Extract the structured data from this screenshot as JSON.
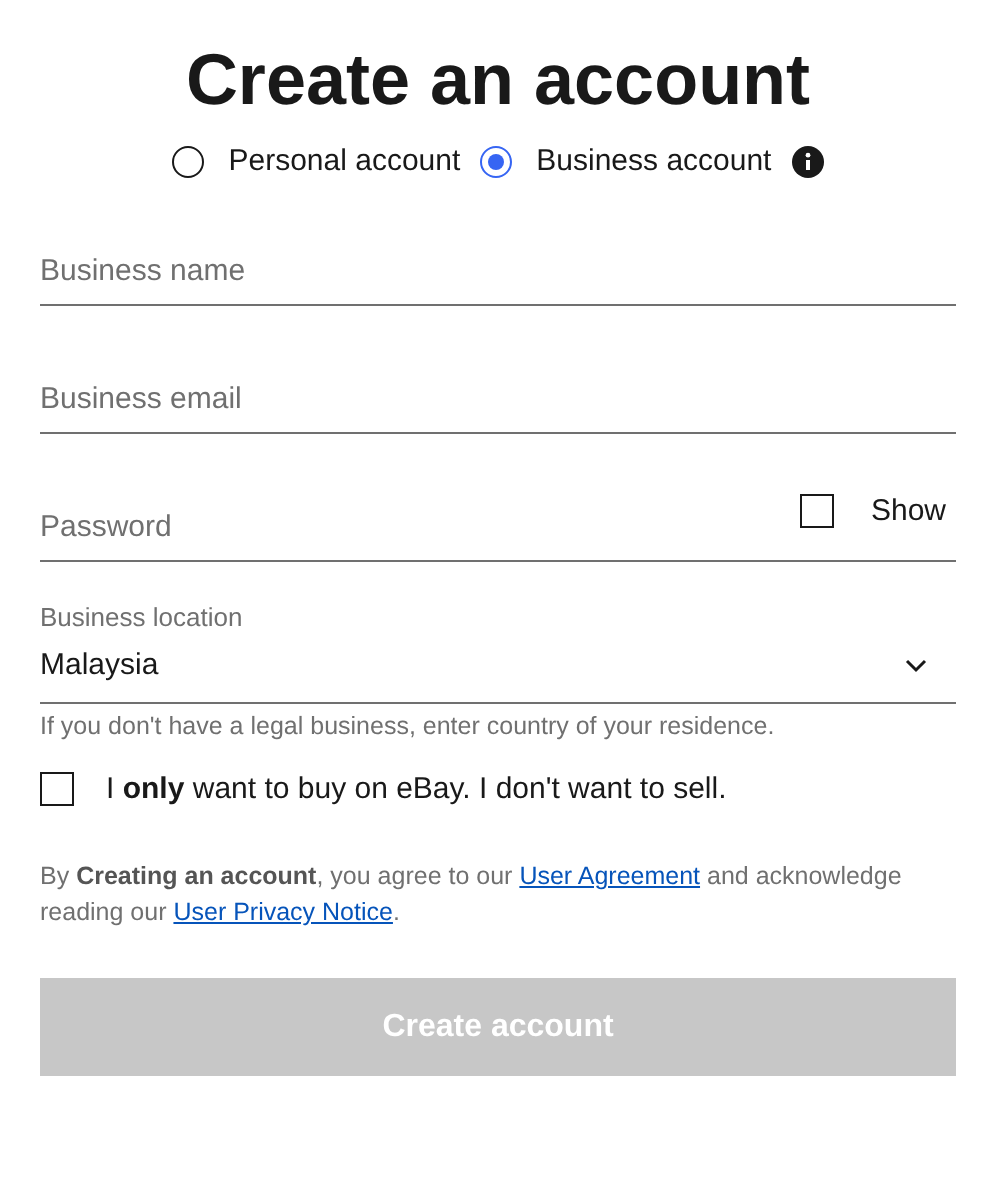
{
  "title": "Create an account",
  "account_types": [
    {
      "label": "Personal account",
      "selected": false
    },
    {
      "label": "Business account",
      "selected": true
    }
  ],
  "fields": [
    {
      "placeholder": "Business name"
    },
    {
      "placeholder": "Business email"
    },
    {
      "placeholder": "Password",
      "show_toggle": {
        "label": "Show",
        "checked": false
      }
    }
  ],
  "location": {
    "label": "Business location",
    "value": "Malaysia",
    "hint": "If you don't have a legal business, enter country of your residence."
  },
  "buy_only": {
    "label": "I **only** want to buy on eBay. I don't want to sell.",
    "checked": false
  },
  "legal": [
    {
      "kind": "text",
      "text": "By **Creating an account**, you agree to our "
    },
    {
      "kind": "link",
      "text": "User Agreement"
    },
    {
      "kind": "text",
      "text": " and acknowledge reading our "
    },
    {
      "kind": "link",
      "text": "User Privacy Notice"
    },
    {
      "kind": "text",
      "text": "."
    }
  ],
  "submit": {
    "label": "Create account",
    "disabled": true
  }
}
